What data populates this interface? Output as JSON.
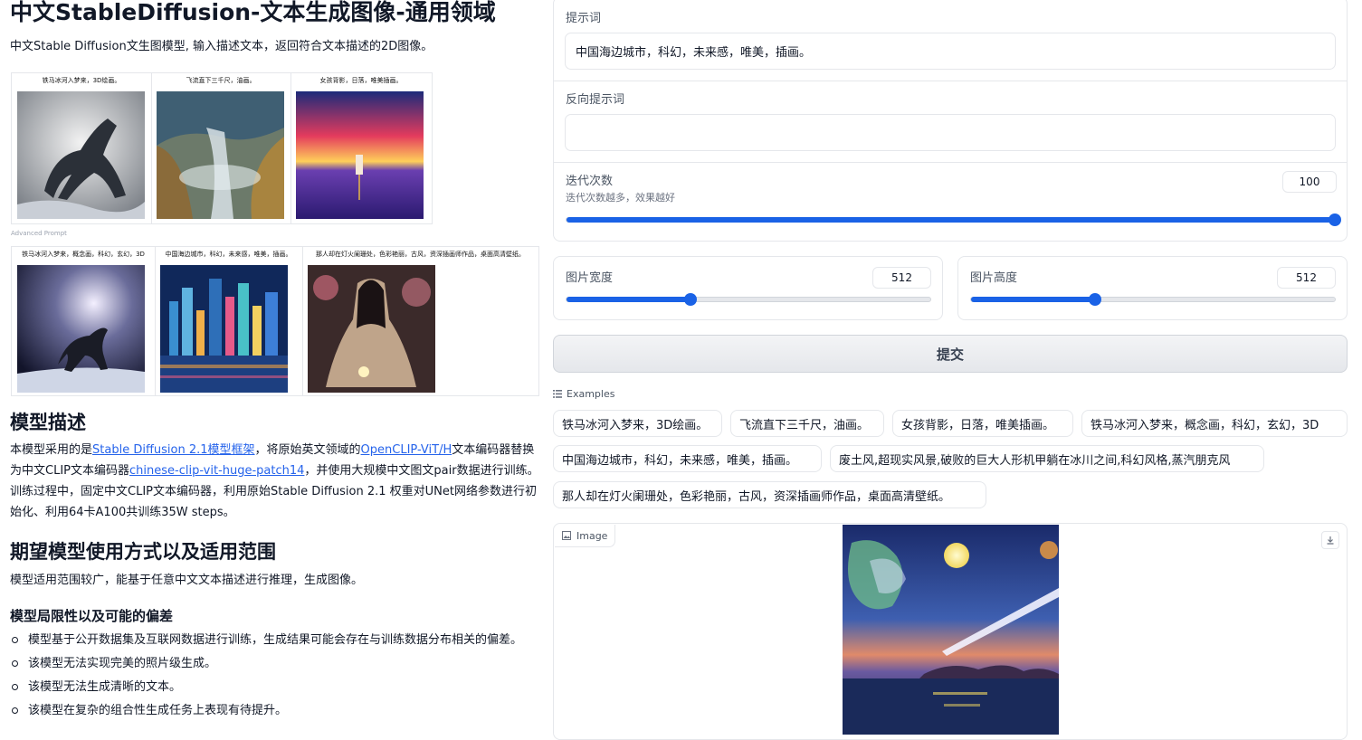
{
  "header": {
    "title": "中文StableDiffusion-文本生成图像-通用领域",
    "intro": "中文Stable Diffusion文生图模型, 输入描述文本，返回符合文本描述的2D图像。"
  },
  "gallery": {
    "row1_captions": [
      "铁马冰河入梦来，3D绘画。",
      "飞流直下三千尺，油画。",
      "女孩背影，日落，唯美插画。"
    ],
    "advanced_label": "Advanced Prompt",
    "row2_captions": [
      "铁马冰河入梦来，概念画，科幻，玄幻，3D",
      "中国海边城市，科幻，未来感，唯美，插画。",
      "那人却在灯火阑珊处，色彩艳丽，古风，资深插画师作品，桌面高清壁纸。"
    ]
  },
  "model_desc": {
    "title": "模型描述",
    "t1": "本模型采用的是",
    "link1": "Stable Diffusion 2.1模型框架",
    "t2": "，将原始英文领域的",
    "link2": "OpenCLIP-ViT/H",
    "t3": "文本编码器替换为中文CLIP文本编码器",
    "link3": "chinese-clip-vit-huge-patch14",
    "t4": "，并使用大规模中文图文pair数据进行训练。训练过程中，固定中文CLIP文本编码器，利用原始Stable Diffusion 2.1 权重对UNet网络参数进行初始化、利用64卡A100共训练35W steps。"
  },
  "usage": {
    "title": "期望模型使用方式以及适用范围",
    "text": "模型适用范围较广，能基于任意中文文本描述进行推理，生成图像。"
  },
  "limits": {
    "title": "模型局限性以及可能的偏差",
    "items": [
      "模型基于公开数据集及互联网数据进行训练，生成结果可能会存在与训练数据分布相关的偏差。",
      "该模型无法实现完美的照片级生成。",
      "该模型无法生成清晰的文本。",
      "该模型在复杂的组合性生成任务上表现有待提升。"
    ]
  },
  "form": {
    "prompt_label": "提示词",
    "prompt_value": "中国海边城市，科幻，未来感，唯美，插画。",
    "neg_label": "反向提示词",
    "neg_value": "",
    "steps_label": "迭代次数",
    "steps_info": "迭代次数越多，效果越好",
    "steps_value": "100",
    "steps_fraction": 1.0,
    "width_label": "图片宽度",
    "width_value": "512",
    "width_fraction": 0.34,
    "height_label": "图片高度",
    "height_value": "512",
    "height_fraction": 0.34,
    "submit_label": "提交"
  },
  "examples": {
    "label": "Examples",
    "items": [
      "铁马冰河入梦来，3D绘画。",
      "飞流直下三千尺，油画。",
      "女孩背影，日落，唯美插画。",
      "铁马冰河入梦来，概念画，科幻，玄幻，3D",
      "中国海边城市，科幻，未来感，唯美，插画。",
      "废土风,超现实风景,破败的巨大人形机甲躺在冰川之间,科幻风格,蒸汽朋克风",
      "那人却在灯火阑珊处，色彩艳丽，古风，资深插画师作品，桌面高清壁纸。"
    ]
  },
  "output": {
    "label": "Image"
  },
  "colors": {
    "accent": "#1a62e6",
    "link": "#2563eb"
  }
}
